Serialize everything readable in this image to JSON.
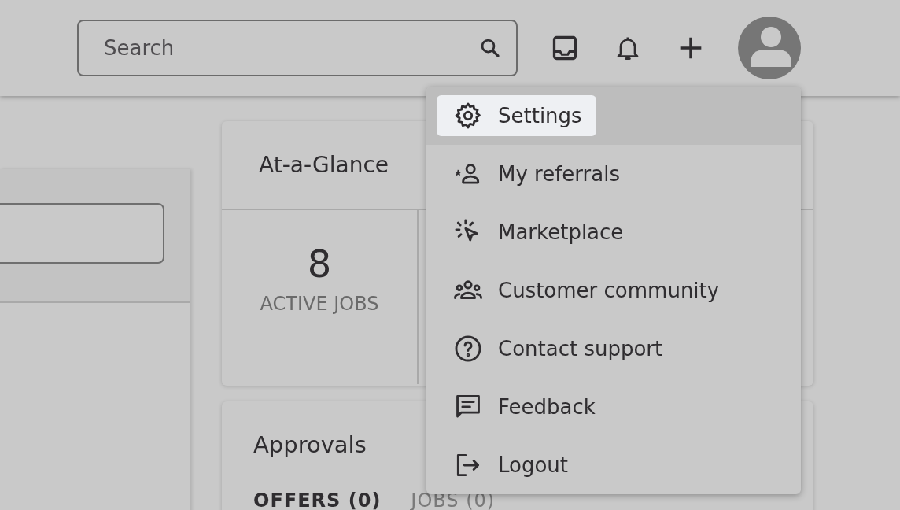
{
  "header": {
    "search": {
      "placeholder": "Search"
    }
  },
  "at_a_glance": {
    "title": "At-a-Glance",
    "stats": [
      {
        "value": "8",
        "label": "ACTIVE JOBS"
      }
    ]
  },
  "approvals": {
    "title": "Approvals",
    "tabs": [
      {
        "label": "OFFERS (0)",
        "selected": true
      },
      {
        "label": "JOBS (0)",
        "selected": false
      }
    ]
  },
  "user_menu": {
    "items": [
      {
        "kind": "settings",
        "label": "Settings",
        "selected": true
      },
      {
        "kind": "referrals",
        "label": "My referrals",
        "selected": false
      },
      {
        "kind": "marketplace",
        "label": "Marketplace",
        "selected": false
      },
      {
        "kind": "community",
        "label": "Customer community",
        "selected": false
      },
      {
        "kind": "support",
        "label": "Contact support",
        "selected": false
      },
      {
        "kind": "feedback",
        "label": "Feedback",
        "selected": false
      },
      {
        "kind": "logout",
        "label": "Logout",
        "selected": false
      }
    ]
  }
}
